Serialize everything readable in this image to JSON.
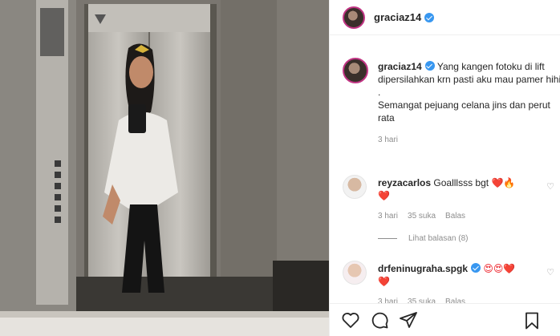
{
  "post": {
    "username": "graciaz14",
    "caption_line1": "Yang kangen fotoku di lift dipersilahkan krn pasti aku mau pamer hihi",
    "caption_dot": ".",
    "caption_line2": "Semangat pejuang celana jins dan perut rata",
    "time": "3 hari"
  },
  "comments": [
    {
      "username": "reyzacarlos",
      "text": "Goalllsss bgt",
      "emojis": "❤️🔥",
      "emoji_line2": "❤️",
      "time": "3 hari",
      "likes": "35 suka",
      "reply": "Balas"
    },
    {
      "username": "drfeninugraha.spgk",
      "text": "",
      "emojis": "😍😍❤️",
      "emoji_line2": "❤️",
      "time": "3 hari",
      "likes": "35 suka",
      "reply": "Balas"
    }
  ],
  "view_replies": "Lihat balasan (8)",
  "colors": {
    "verified": "#3897f0",
    "border": "#efefef",
    "muted": "#8e8e8e",
    "avatar_ring": "#c13584"
  },
  "icons": [
    "heart-icon",
    "comment-icon",
    "share-icon",
    "bookmark-icon",
    "verified-badge-icon",
    "like-comment-icon"
  ]
}
